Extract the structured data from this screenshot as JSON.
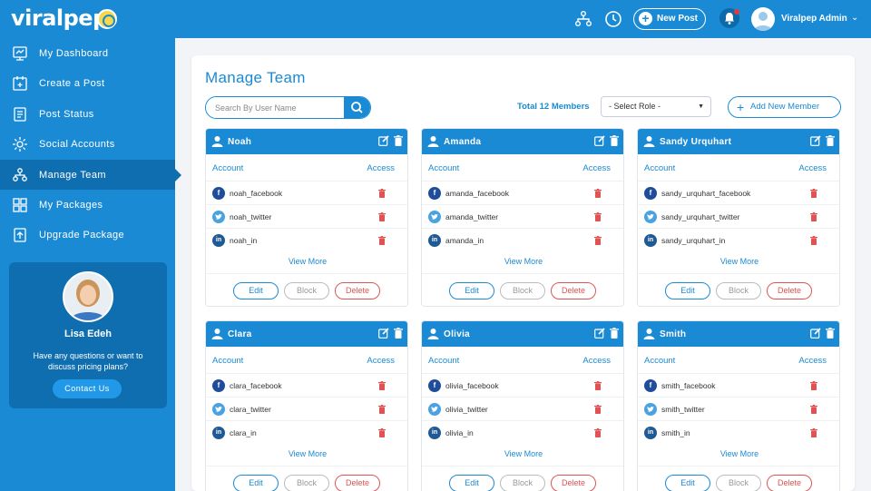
{
  "app": {
    "logo": "viralpep"
  },
  "topbar": {
    "new_post_label": "New Post",
    "user_name": "Viralpep Admin"
  },
  "sidebar": {
    "items": [
      {
        "label": "My Dashboard",
        "icon": "dashboard-icon",
        "active": false
      },
      {
        "label": "Create a Post",
        "icon": "create-post-icon",
        "active": false
      },
      {
        "label": "Post Status",
        "icon": "post-status-icon",
        "active": false
      },
      {
        "label": "Social Accounts",
        "icon": "gear-icon",
        "active": false
      },
      {
        "label": "Manage Team",
        "icon": "team-icon",
        "active": true
      },
      {
        "label": "My Packages",
        "icon": "packages-icon",
        "active": false
      },
      {
        "label": "Upgrade Package",
        "icon": "upgrade-icon",
        "active": false
      }
    ],
    "support": {
      "name": "Lisa Edeh",
      "text": "Have any questions or want to discuss pricing plans?",
      "button": "Contact Us"
    }
  },
  "main": {
    "title": "Manage Team",
    "search_placeholder": "Search By User Name",
    "total_members": "Total 12 Members",
    "role_select": "- Select Role -",
    "add_member": "Add New Member",
    "col_account": "Account",
    "col_access": "Access",
    "view_more": "View More",
    "btn_edit": "Edit",
    "btn_block": "Block",
    "btn_delete": "Delete",
    "members": [
      {
        "name": "Noah",
        "accounts": [
          "noah_facebook",
          "noah_twitter",
          "noah_in"
        ]
      },
      {
        "name": "Amanda",
        "accounts": [
          "amanda_facebook",
          "amanda_twitter",
          "amanda_in"
        ]
      },
      {
        "name": "Sandy Urquhart",
        "accounts": [
          "sandy_urquhart_facebook",
          "sandy_urquhart_twitter",
          "sandy_urquhart_in"
        ]
      },
      {
        "name": "Clara",
        "accounts": [
          "clara_facebook",
          "clara_twitter",
          "clara_in"
        ]
      },
      {
        "name": "Olivia",
        "accounts": [
          "olivia_facebook",
          "olivia_twitter",
          "olivia_in"
        ]
      },
      {
        "name": "Smith",
        "accounts": [
          "smith_facebook",
          "smith_twitter",
          "smith_in"
        ]
      }
    ]
  },
  "colors": {
    "primary": "#1a8ad4",
    "sidebar_active": "#0f6eb0",
    "danger": "#e15353",
    "facebook": "#1f4d9a",
    "twitter": "#4aa3e0",
    "linkedin": "#1f5a94"
  }
}
